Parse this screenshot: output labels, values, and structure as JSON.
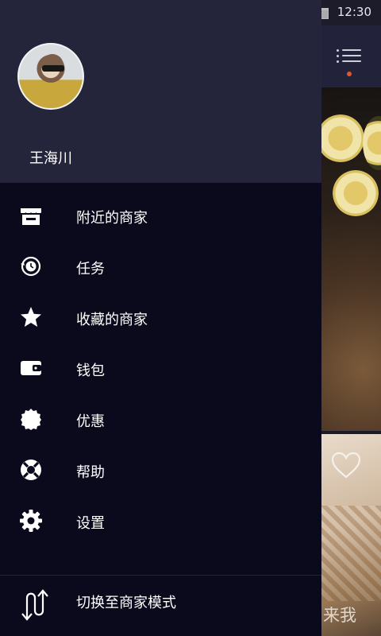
{
  "status_bar": {
    "time": "12:30"
  },
  "background": {
    "overlay_text": "来我"
  },
  "drawer": {
    "user": {
      "name": "王海川"
    },
    "menu_items": [
      {
        "label": "附近的商家",
        "icon": "store-icon"
      },
      {
        "label": "任务",
        "icon": "task-clock-icon"
      },
      {
        "label": "收藏的商家",
        "icon": "star-icon"
      },
      {
        "label": "钱包",
        "icon": "wallet-icon"
      },
      {
        "label": "优惠",
        "icon": "discount-badge-icon"
      },
      {
        "label": "帮助",
        "icon": "lifebuoy-icon"
      },
      {
        "label": "设置",
        "icon": "gear-icon"
      }
    ],
    "switch_mode": {
      "label": "切换至商家模式",
      "icon": "switch-arrows-icon"
    }
  },
  "colors": {
    "drawer_bg": "#0b0a1c",
    "header_bg": "#24243a",
    "text": "#ffffff",
    "notification_dot": "#e0572f"
  }
}
